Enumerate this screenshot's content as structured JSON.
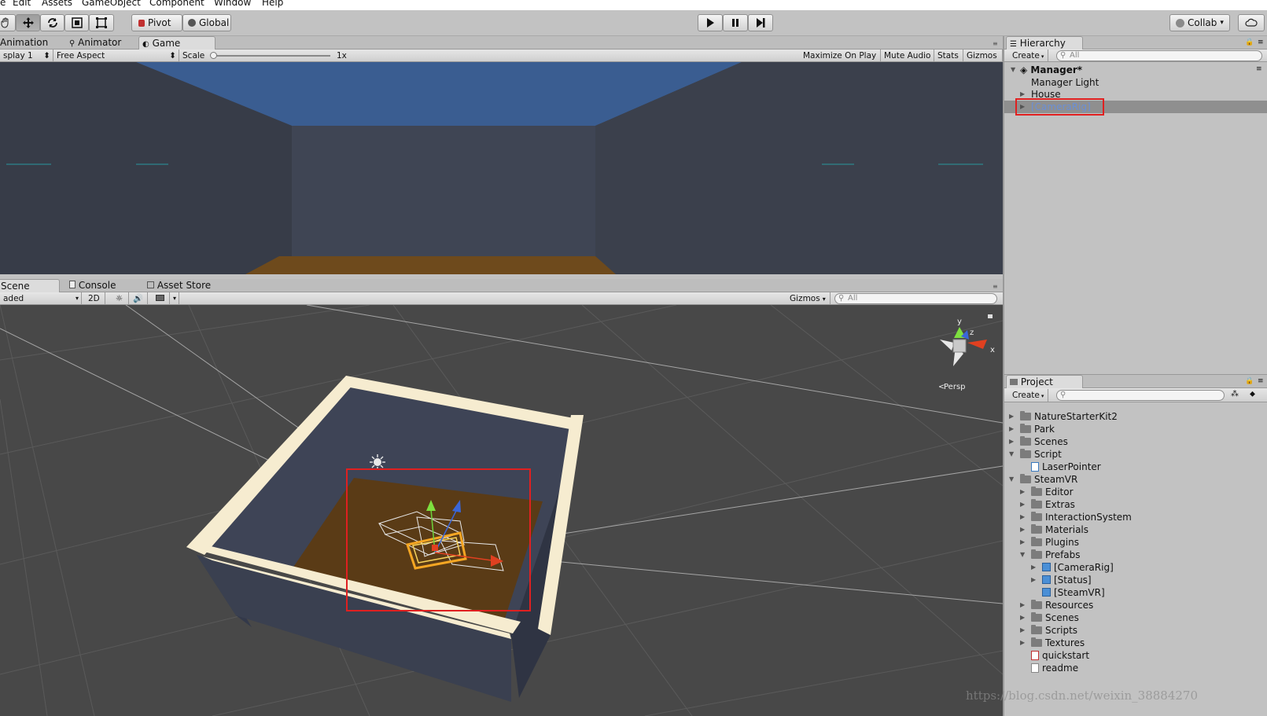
{
  "menu": [
    "e",
    "Edit",
    "Assets",
    "GameObject",
    "Component",
    "Window",
    "Help"
  ],
  "toolbar": {
    "pivot_label": "Pivot",
    "global_label": "Global",
    "collab_label": "Collab",
    "collab_arrow": "▾"
  },
  "game": {
    "tabs": [
      "Animation",
      "Animator",
      "Game"
    ],
    "display": "splay 1",
    "aspect": "Free Aspect",
    "scale_label": "Scale",
    "scale_value": "1x",
    "buttons": [
      "Maximize On Play",
      "Mute Audio",
      "Stats",
      "Gizmos"
    ]
  },
  "scene": {
    "tabs": [
      "Scene",
      "Console",
      "Asset Store"
    ],
    "shading": "aded",
    "mode_2d": "2D",
    "gizmos": "Gizmos",
    "search_placeholder": "All",
    "axis_y": "y",
    "axis_z": "z",
    "axis_x": "x",
    "persp": "Persp"
  },
  "hierarchy": {
    "title": "Hierarchy",
    "create": "Create",
    "search_placeholder": "All",
    "scene_name": "Manager*",
    "items": [
      "Manager Light",
      "House",
      "[CameraRig]"
    ]
  },
  "project": {
    "title": "Project",
    "create": "Create",
    "items": [
      {
        "label": "NatureStarterKit2",
        "type": "folder"
      },
      {
        "label": "Park",
        "type": "folder"
      },
      {
        "label": "Scenes",
        "type": "folder"
      },
      {
        "label": "Script",
        "type": "folder"
      },
      {
        "label": "LaserPointer",
        "type": "script"
      },
      {
        "label": "SteamVR",
        "type": "folder"
      },
      {
        "label": "Editor",
        "type": "folder"
      },
      {
        "label": "Extras",
        "type": "folder"
      },
      {
        "label": "InteractionSystem",
        "type": "folder"
      },
      {
        "label": "Materials",
        "type": "folder"
      },
      {
        "label": "Plugins",
        "type": "folder"
      },
      {
        "label": "Prefabs",
        "type": "folder"
      },
      {
        "label": "[CameraRig]",
        "type": "prefab"
      },
      {
        "label": "[Status]",
        "type": "prefab"
      },
      {
        "label": "[SteamVR]",
        "type": "prefab"
      },
      {
        "label": "Resources",
        "type": "folder"
      },
      {
        "label": "Scenes",
        "type": "folder"
      },
      {
        "label": "Scripts",
        "type": "folder"
      },
      {
        "label": "Textures",
        "type": "folder"
      },
      {
        "label": "quickstart",
        "type": "pdf"
      },
      {
        "label": "readme",
        "type": "text"
      }
    ]
  },
  "watermark": "https://blog.csdn.net/weixin_38884270",
  "colors": {
    "highlight_red": "#e02020",
    "selection_text": "#6b8fd6",
    "sky": "#3d5a8c",
    "floor": "#6b4417",
    "wall": "#3c4352",
    "scene_bg": "#474747"
  }
}
